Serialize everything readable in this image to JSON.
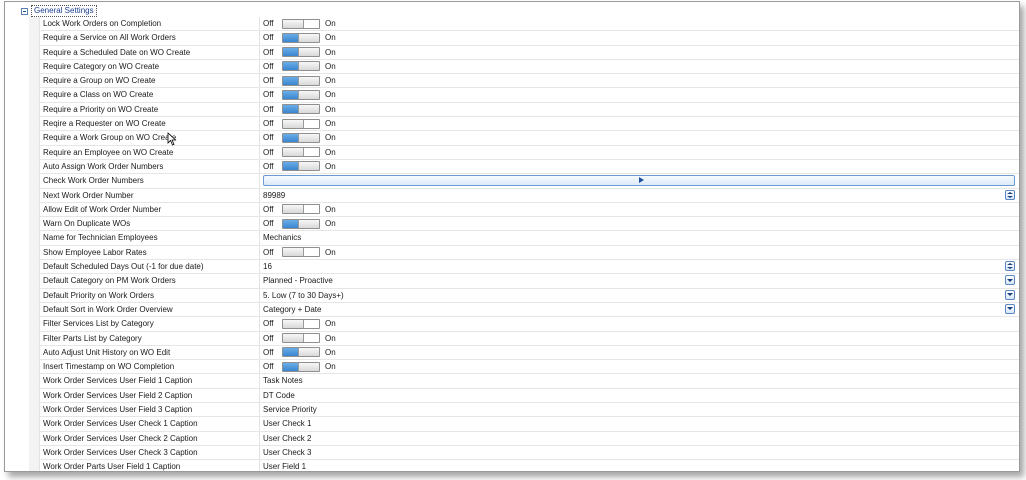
{
  "group": {
    "title": "General Settings"
  },
  "toggle_labels": {
    "off": "Off",
    "on": "On"
  },
  "rows": [
    {
      "label": "Lock Work Orders on Completion",
      "type": "toggle",
      "on": false
    },
    {
      "label": "Require a Service on All Work Orders",
      "type": "toggle",
      "on": true
    },
    {
      "label": "Require a Scheduled Date on WO Create",
      "type": "toggle",
      "on": true
    },
    {
      "label": "Require Category on WO Create",
      "type": "toggle",
      "on": true
    },
    {
      "label": "Require a Group on WO Create",
      "type": "toggle",
      "on": true
    },
    {
      "label": "Require a Class on WO Create",
      "type": "toggle",
      "on": true
    },
    {
      "label": "Require a Priority on WO Create",
      "type": "toggle",
      "on": true
    },
    {
      "label": "Reqire a Requester on WO Create",
      "type": "toggle",
      "on": false
    },
    {
      "label": "Require a Work Group on WO Create",
      "type": "toggle",
      "on": true
    },
    {
      "label": "Require an Employee on WO Create",
      "type": "toggle",
      "on": false
    },
    {
      "label": "Auto Assign Work Order Numbers",
      "type": "toggle",
      "on": true
    },
    {
      "label": "Check Work Order Numbers",
      "type": "action"
    },
    {
      "label": "Next Work Order Number",
      "type": "spin",
      "value": "89989"
    },
    {
      "label": "Allow Edit of Work Order Number",
      "type": "toggle",
      "on": false
    },
    {
      "label": "Warn On Duplicate WOs",
      "type": "toggle",
      "on": true
    },
    {
      "label": "Name for Technician Employees",
      "type": "text",
      "value": "Mechanics"
    },
    {
      "label": "Show Employee Labor Rates",
      "type": "toggle",
      "on": false
    },
    {
      "label": "Default Scheduled Days Out (-1 for due date)",
      "type": "spin",
      "value": "16"
    },
    {
      "label": "Default Category on PM Work Orders",
      "type": "dropdown",
      "value": "Planned - Proactive"
    },
    {
      "label": "Default Priority on Work Orders",
      "type": "dropdown",
      "value": "5. Low (7 to 30 Days+)"
    },
    {
      "label": "Default Sort in Work Order Overview",
      "type": "dropdown",
      "value": "Category + Date"
    },
    {
      "label": "Filter Services List by Category",
      "type": "toggle",
      "on": false
    },
    {
      "label": "Filter Parts List by Category",
      "type": "toggle",
      "on": false
    },
    {
      "label": "Auto Adjust Unit History on WO Edit",
      "type": "toggle",
      "on": true
    },
    {
      "label": "Insert Timestamp on WO Completion",
      "type": "toggle",
      "on": true
    },
    {
      "label": "Work Order Services User Field 1 Caption",
      "type": "text",
      "value": "Task Notes"
    },
    {
      "label": "Work Order Services User Field 2 Caption",
      "type": "text",
      "value": "DT Code"
    },
    {
      "label": "Work Order Services User Field 3 Caption",
      "type": "text",
      "value": "Service Priority"
    },
    {
      "label": "Work Order Services User Check 1 Caption",
      "type": "text",
      "value": "User Check 1"
    },
    {
      "label": "Work Order Services User Check 2 Caption",
      "type": "text",
      "value": "User Check 2"
    },
    {
      "label": "Work Order Services User Check 3 Caption",
      "type": "text",
      "value": "User Check 3"
    },
    {
      "label": "Work Order Parts User Field 1 Caption",
      "type": "text",
      "value": "User Field 1"
    }
  ]
}
